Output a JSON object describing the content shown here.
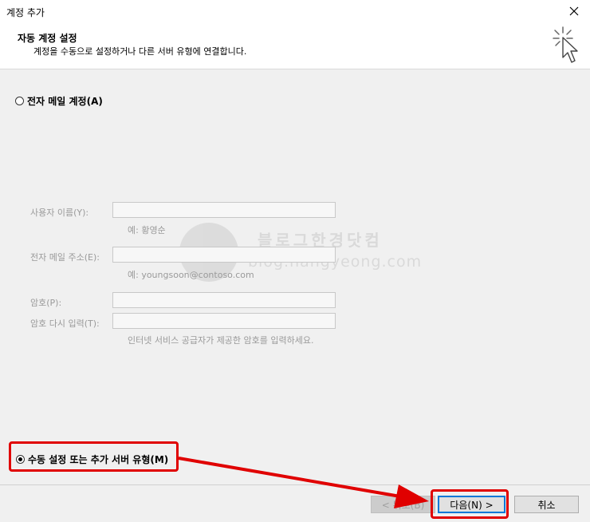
{
  "window": {
    "title": "계정 추가"
  },
  "header": {
    "title": "자동 계정 설정",
    "subtitle": "계정을 수동으로 설정하거나 다른 서버 유형에 연결합니다."
  },
  "options": {
    "email_account": {
      "label": "전자 메일 계정(A)",
      "selected": false
    },
    "manual_setup": {
      "label": "수동 설정 또는 추가 서버 유형(M)",
      "selected": true
    }
  },
  "form": {
    "name_label": "사용자 이름(Y):",
    "name_example": "예: 황영순",
    "email_label": "전자 메일 주소(E):",
    "email_example": "예: youngsoon@contoso.com",
    "password_label": "암호(P):",
    "password_confirm_label": "암호 다시 입력(T):",
    "password_hint": "인터넷 서비스 공급자가 제공한 암호를 입력하세요."
  },
  "buttons": {
    "back": "< 뒤로(B)",
    "next": "다음(N) >",
    "cancel": "취소"
  },
  "watermark": {
    "line1": "블로그한경닷컴",
    "line2": "blog.hangyeong.com"
  },
  "colors": {
    "highlight": "#e00000",
    "default_button_border": "#0078d7",
    "content_bg": "#f0f0f0"
  },
  "icons": {
    "close": "close-icon",
    "setup": "cursor-sparkle-icon"
  }
}
